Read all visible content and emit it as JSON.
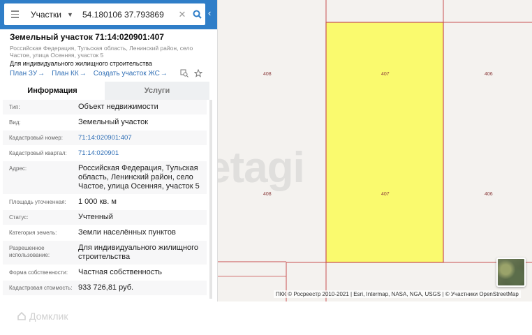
{
  "search": {
    "category": "Участки",
    "coordinates": "54.180106 37.793869"
  },
  "parcel": {
    "title": "Земельный участок 71:14:020901:407",
    "address_sub": "Российская Федерация, Тульская область, Ленинский район, село Частое, улица Осенняя, участок 5",
    "purpose": "Для индивидуального жилищного строительства",
    "links": [
      "План ЗУ",
      "План КК",
      "Создать участок ЖС"
    ]
  },
  "tabs": [
    "Информация",
    "Услуги"
  ],
  "info_rows": [
    {
      "label": "Тип:",
      "value": "Объект недвижимости"
    },
    {
      "label": "Вид:",
      "value": "Земельный участок"
    },
    {
      "label": "Кадастровый номер:",
      "value": "71:14:020901:407"
    },
    {
      "label": "Кадастровый квартал:",
      "value": "71:14:020901"
    },
    {
      "label": "Адрес:",
      "value": "Российская Федерация, Тульская область, Ленинский район, село Частое, улица Осенняя, участок 5"
    },
    {
      "label": "Площадь уточненная:",
      "value": "1 000 кв. м"
    },
    {
      "label": "Статус:",
      "value": "Учтенный"
    },
    {
      "label": "Категория земель:",
      "value": "Земли населённых пунктов"
    },
    {
      "label": "Разрешенное использование:",
      "value": "Для индивидуального жилищного строительства"
    },
    {
      "label": "Форма собственности:",
      "value": "Частная собственность"
    },
    {
      "label": "Кадастровая стоимость:",
      "value": "933 726,81 руб."
    }
  ],
  "map": {
    "plot_labels": [
      "408",
      "407",
      "406",
      "408",
      "407",
      "406"
    ],
    "watermark": "etagi",
    "attribution": "ПКК © Росреестр 2010-2021 | Esri, Intermap, NASA, NGA, USGS | © Участники OpenStreetMap",
    "highlight_color": "#fafa6e",
    "boundary_color": "#c85050"
  },
  "footer": {
    "logo_text": "Домклик"
  }
}
